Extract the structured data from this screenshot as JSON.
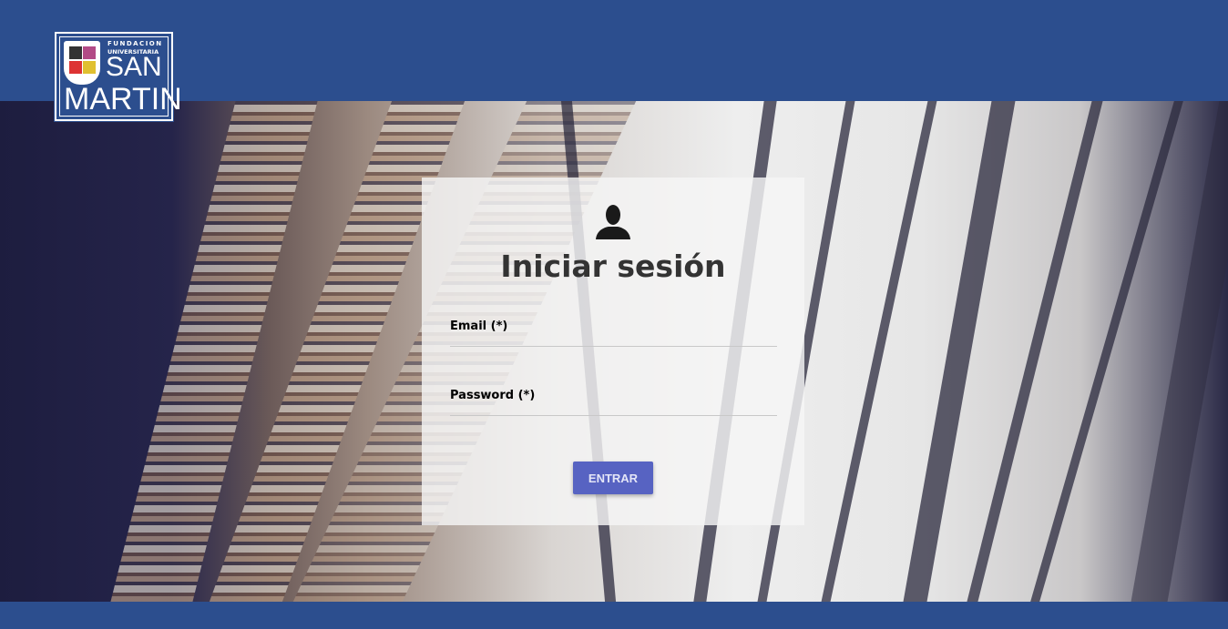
{
  "logo": {
    "line1": "FUNDACION",
    "line2": "UNIVERSITARIA",
    "line3": "SAN",
    "line4": "MARTIN"
  },
  "login": {
    "icon": "user-icon",
    "title": "Iniciar sesión",
    "email_label": "Email (*)",
    "email_value": "",
    "password_label": "Password (*)",
    "password_value": "",
    "submit_label": "ENTRAR"
  },
  "colors": {
    "brand": "#2c4e8e",
    "button": "#5763c2"
  }
}
